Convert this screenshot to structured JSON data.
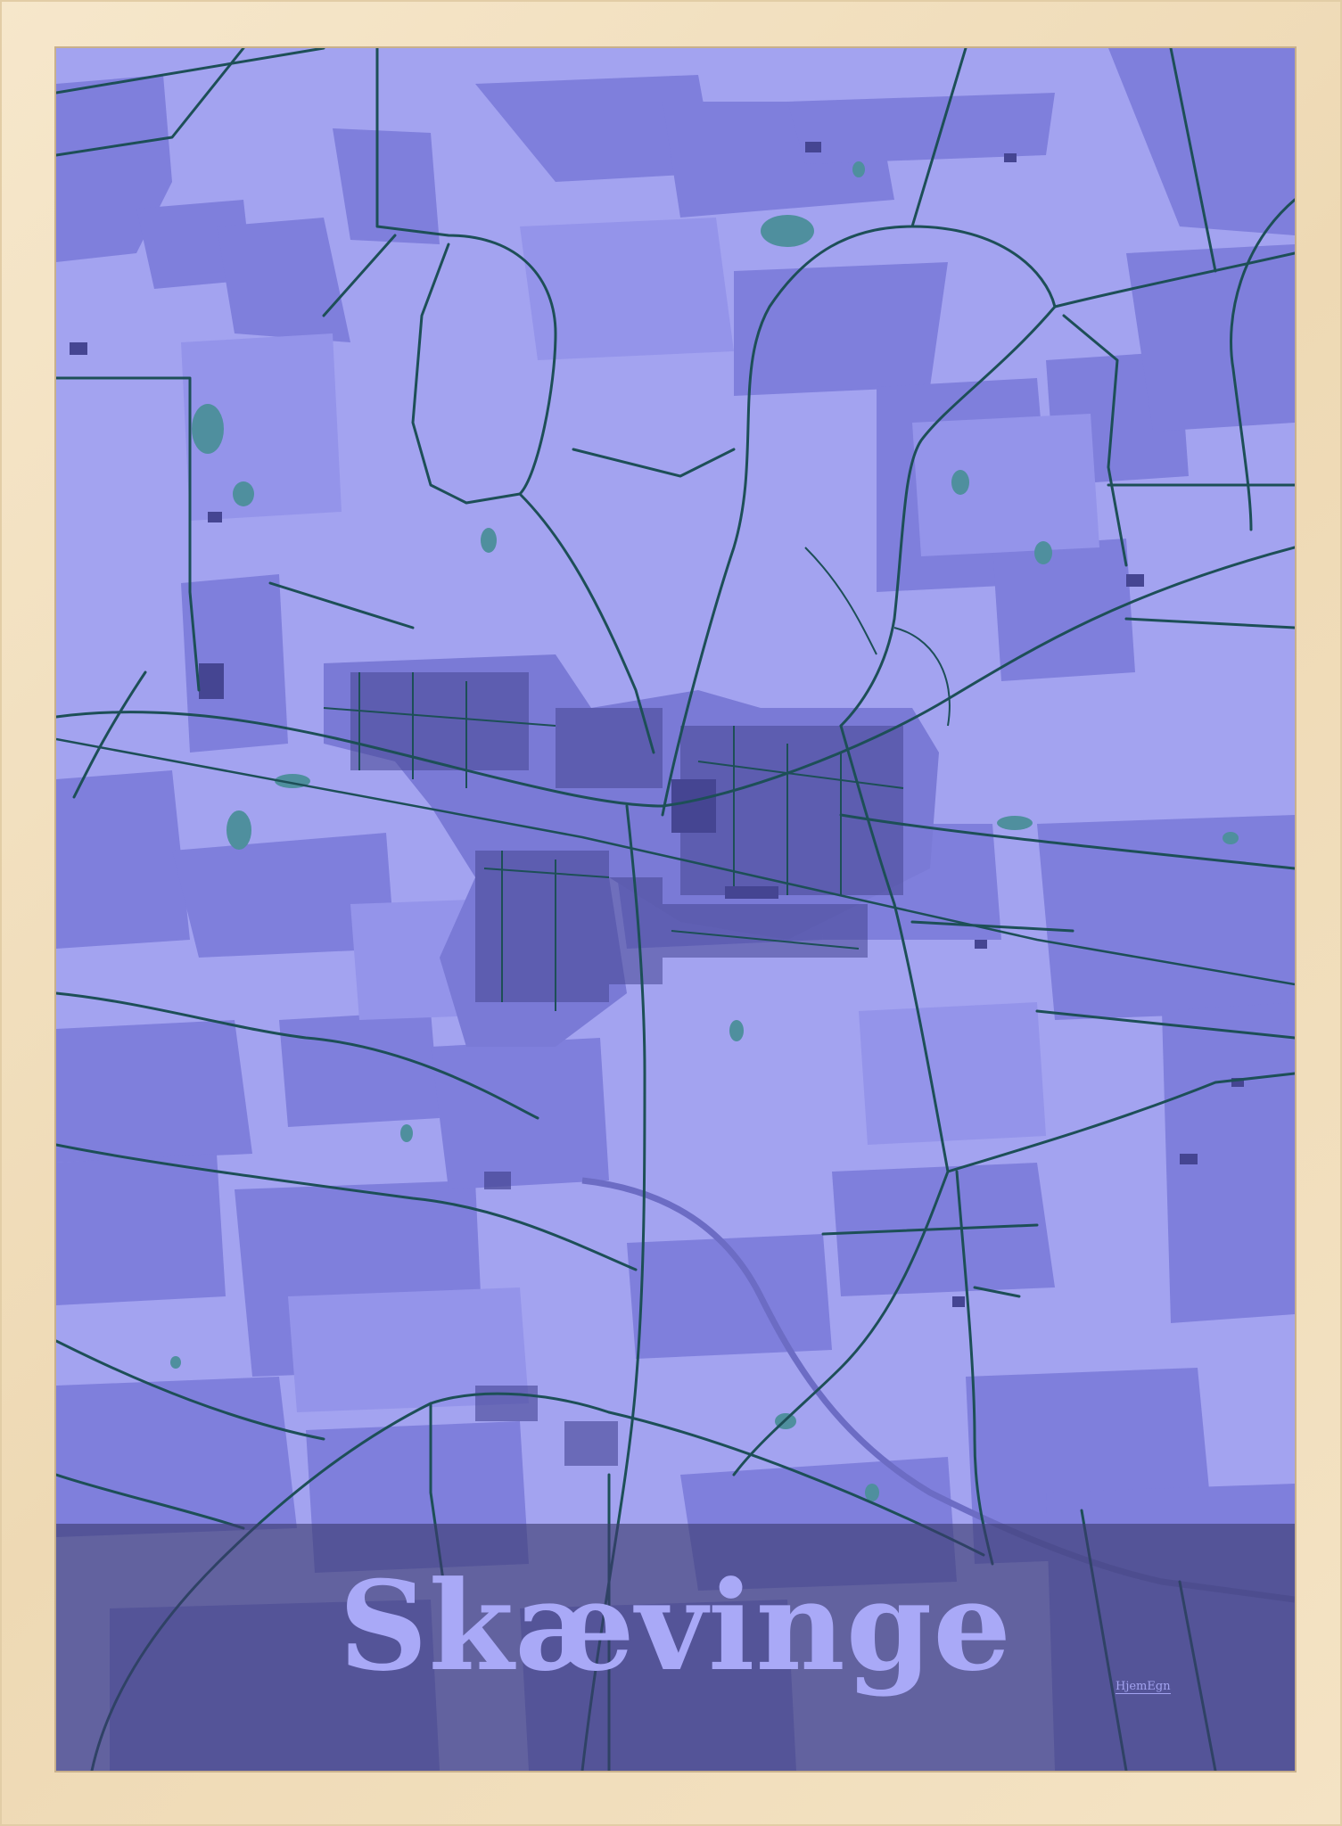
{
  "poster": {
    "city_name": "Skævinge",
    "brand": "HjemEgn"
  },
  "colors": {
    "frame_wood": "#f2e2c4",
    "map_background": "#a3a3f0",
    "field_dark": "#7f7fdc",
    "field_mid": "#9292e8",
    "water": "#4f8f9e",
    "road": "#1d4f57",
    "building": "#454592",
    "title_band": "#3a3a6e",
    "title_text": "#a9a9f7"
  }
}
